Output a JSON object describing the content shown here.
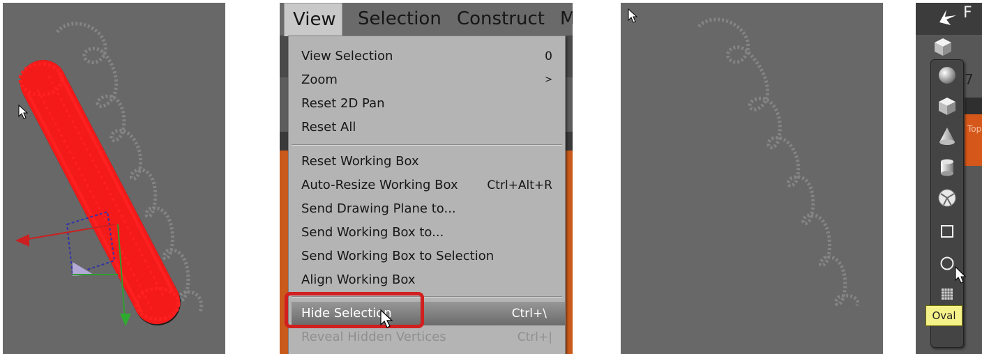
{
  "menu_panel": {
    "menubar": [
      "View",
      "Selection",
      "Construct",
      "M"
    ],
    "items": [
      {
        "label": "View Selection",
        "shortcut": "0"
      },
      {
        "label": "Zoom",
        "shortcut": ">"
      },
      {
        "label": "Reset 2D Pan",
        "shortcut": ""
      },
      {
        "label": "Reset All",
        "shortcut": ""
      },
      {
        "label": "Reset Working Box",
        "shortcut": ""
      },
      {
        "label": "Auto-Resize Working Box",
        "shortcut": "Ctrl+Alt+R"
      },
      {
        "label": "Send Drawing Plane to...",
        "shortcut": ""
      },
      {
        "label": "Send Working Box to...",
        "shortcut": ""
      },
      {
        "label": "Send Working Box to Selection",
        "shortcut": ""
      },
      {
        "label": "Align Working Box",
        "shortcut": ""
      },
      {
        "label": "Hide Selection",
        "shortcut": "Ctrl+\\"
      },
      {
        "label": "Reveal Hidden Vertices",
        "shortcut": "Ctrl+|"
      }
    ],
    "highlighted_item": "Hide Selection",
    "disabled_item": "Reveal Hidden Vertices"
  },
  "toolbar_panel": {
    "title_fragment": "F",
    "side_text": "Top",
    "side_number": "7",
    "palette_icons": [
      "sphere-icon",
      "cube-icon",
      "cone-icon",
      "cylinder-icon",
      "globe-icon",
      "square-icon",
      "oval-icon",
      "grid-icon"
    ],
    "tooltip": "Oval"
  },
  "colors": {
    "viewport_bg": "#686868",
    "selection_red": "#ff1a1a",
    "callout_red": "#d21f1f",
    "orange_panel": "#c95a1c",
    "tooltip_bg": "#f6f28a"
  }
}
